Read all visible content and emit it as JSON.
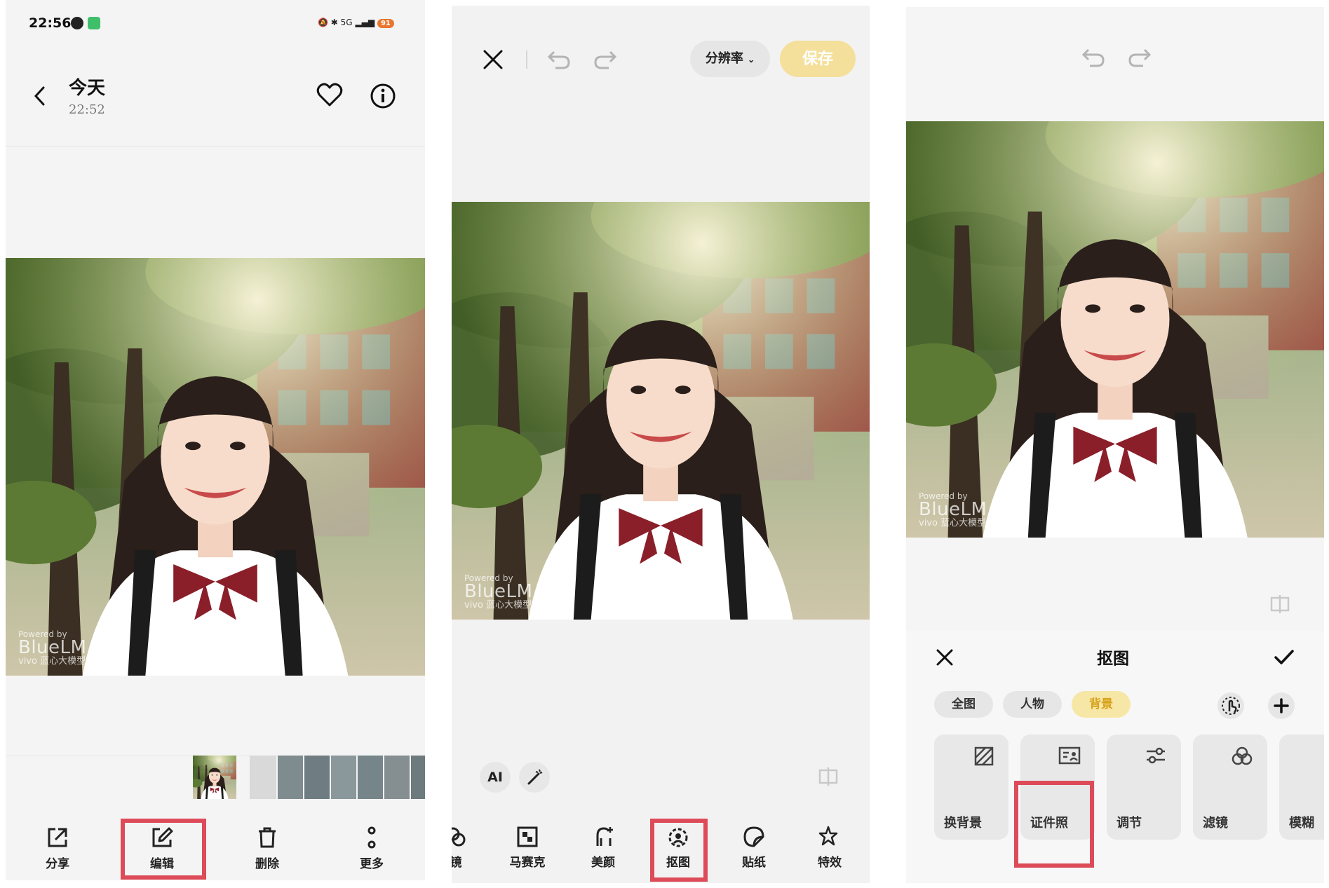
{
  "panel1": {
    "status": {
      "time": "22:56",
      "signal": "5G",
      "battery": "91"
    },
    "header": {
      "title": "今天",
      "subtitle": "22:52"
    },
    "toolbar": [
      {
        "label": "分享",
        "icon": "share-icon"
      },
      {
        "label": "编辑",
        "icon": "edit-icon"
      },
      {
        "label": "删除",
        "icon": "trash-icon"
      },
      {
        "label": "更多",
        "icon": "more-icon"
      }
    ]
  },
  "panel2": {
    "resolution_label": "分辨率",
    "save_label": "保存",
    "ai_label": "AI",
    "tools": [
      {
        "label": "镜",
        "icon": "filter-icon"
      },
      {
        "label": "马赛克",
        "icon": "mosaic-icon"
      },
      {
        "label": "美颜",
        "icon": "beauty-icon"
      },
      {
        "label": "抠图",
        "icon": "cutout-icon"
      },
      {
        "label": "贴纸",
        "icon": "sticker-icon"
      },
      {
        "label": "特效",
        "icon": "effects-icon"
      }
    ]
  },
  "panel3": {
    "sheet_title": "抠图",
    "segments": [
      "全图",
      "人物",
      "背景"
    ],
    "selected_segment": "背景",
    "cards": [
      {
        "label": "换背景",
        "icon": "replace-background-icon"
      },
      {
        "label": "证件照",
        "icon": "id-photo-icon"
      },
      {
        "label": "调节",
        "icon": "adjust-icon"
      },
      {
        "label": "滤镜",
        "icon": "filter-icon"
      },
      {
        "label": "模糊",
        "icon": "blur-icon"
      }
    ]
  },
  "watermark": {
    "line1": "Powered by",
    "line2": "BlueLM",
    "line3": "vivo 蓝心大模型 生成"
  },
  "colors": {
    "highlight": "#dd4b59",
    "save_button": "#f4e09b",
    "selected_pill": "#f7e7a6",
    "selected_pill_text": "#d8a21c"
  }
}
